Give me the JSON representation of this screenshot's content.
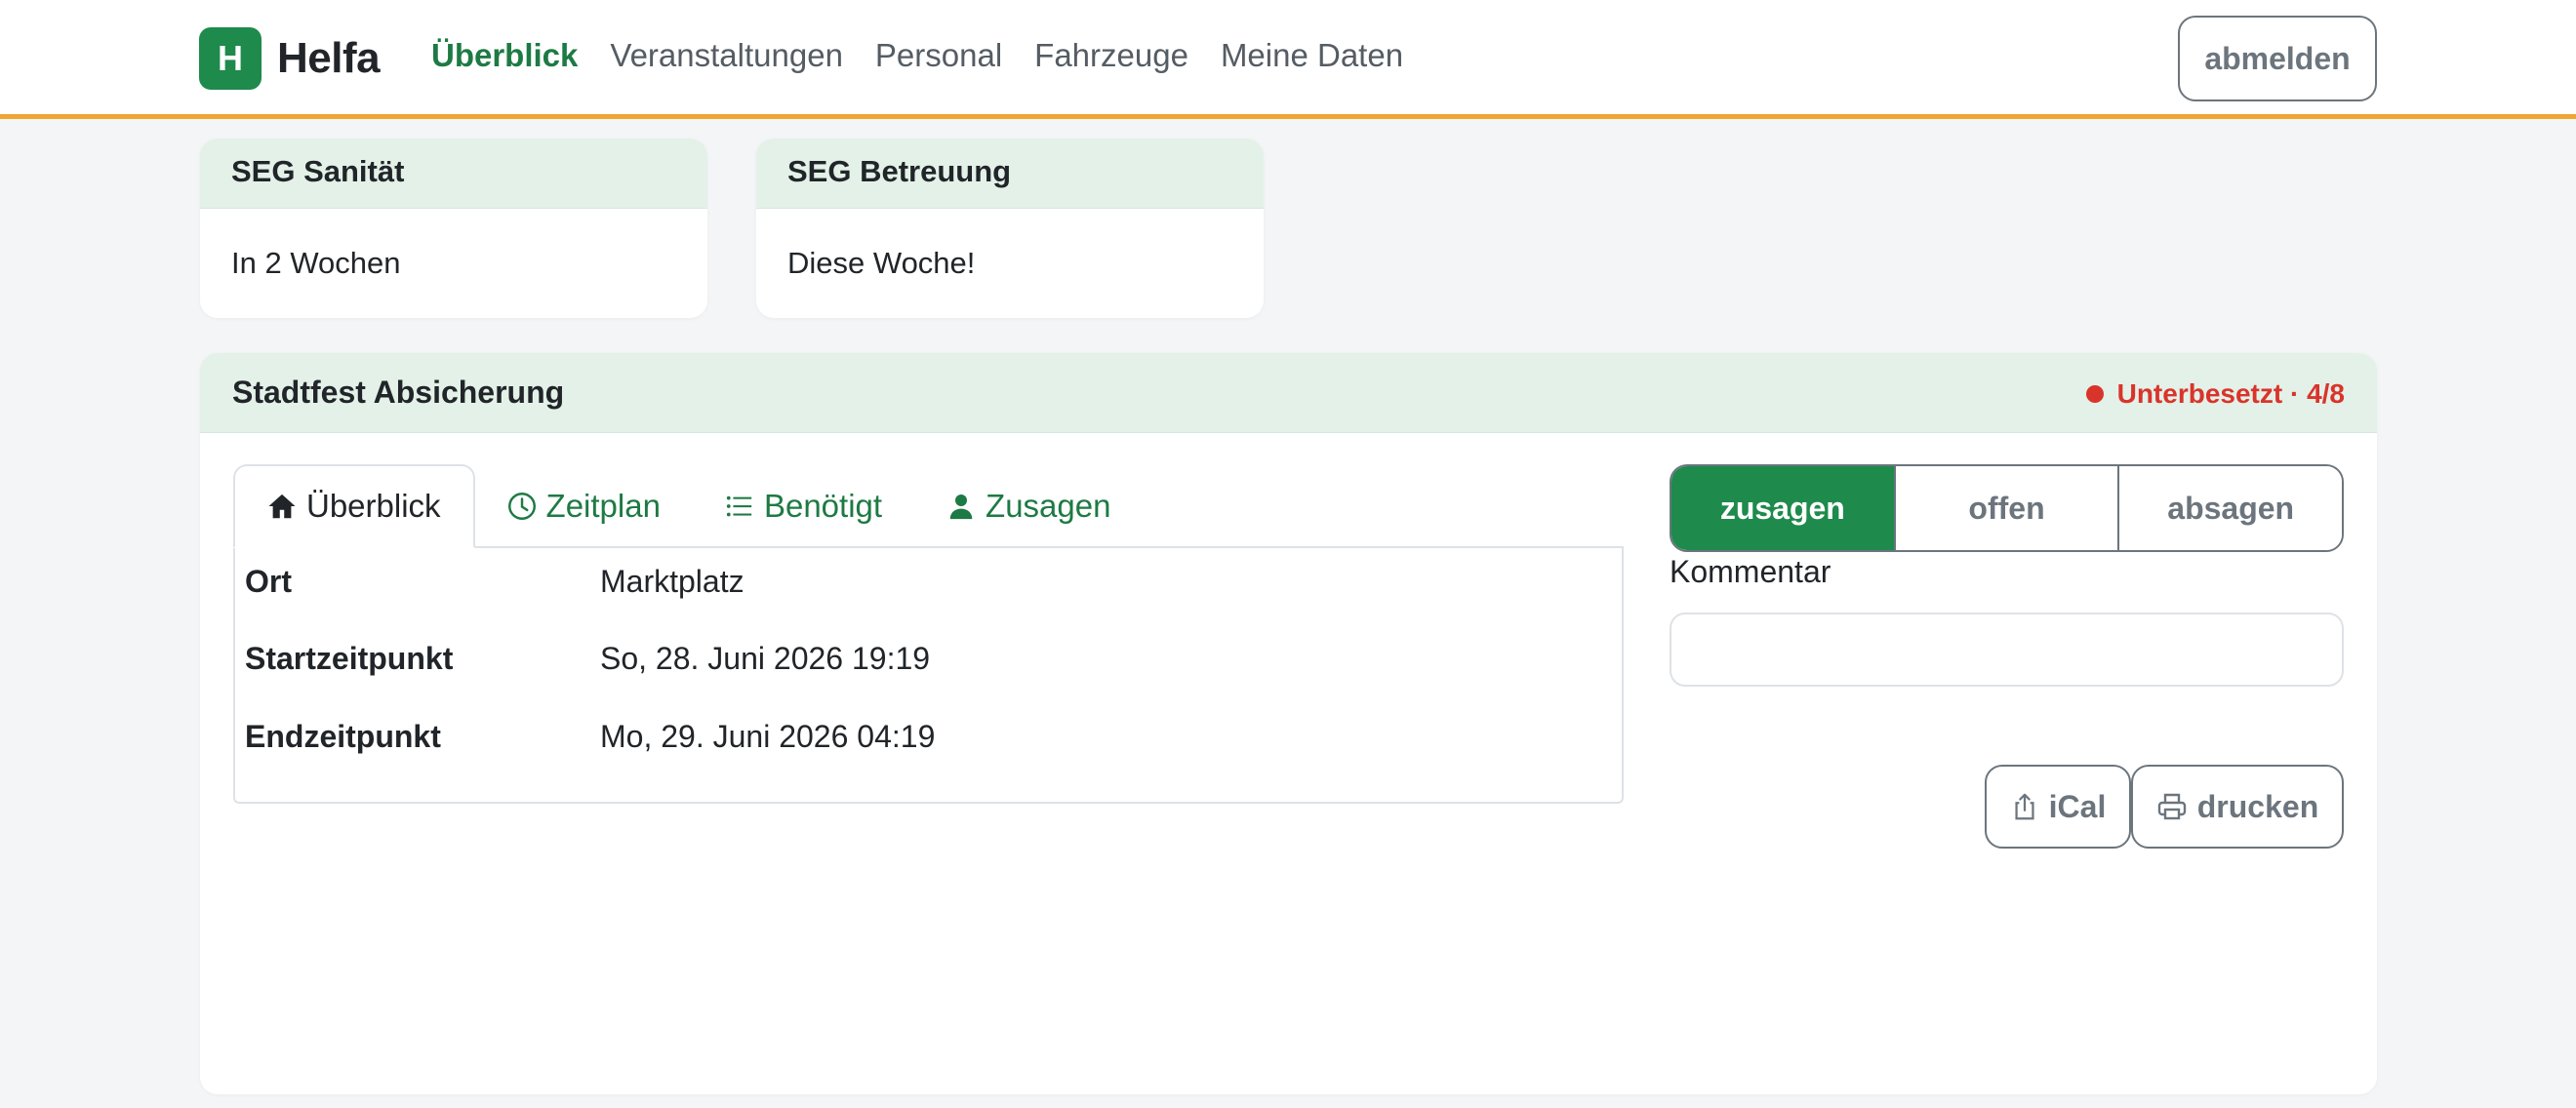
{
  "brand": {
    "logo_letter": "H",
    "name": "Helfa",
    "logo_color": "#1e8a4c"
  },
  "nav": {
    "items": [
      {
        "label": "Überblick",
        "active": true
      },
      {
        "label": "Veranstaltungen",
        "active": false
      },
      {
        "label": "Personal",
        "active": false
      },
      {
        "label": "Fahrzeuge",
        "active": false
      },
      {
        "label": "Meine Daten",
        "active": false
      }
    ],
    "logout_label": "abmelden",
    "accent_color": "#f0a531"
  },
  "groups": [
    {
      "name": "SEG Sanität",
      "info": "In 2 Wochen"
    },
    {
      "name": "SEG Betreuung",
      "info": "Diese Woche!"
    }
  ],
  "event": {
    "title": "Stadtfest Absicherung",
    "status": "Unterbesetzt · 4/8",
    "status_color": "#d9342b",
    "tabs": [
      {
        "label": "Überblick",
        "icon": "home-icon",
        "active": true
      },
      {
        "label": "Zeitplan",
        "icon": "clock-icon",
        "active": false
      },
      {
        "label": "Benötigt",
        "icon": "list-icon",
        "active": false
      },
      {
        "label": "Zusagen",
        "icon": "person-icon",
        "active": false
      }
    ],
    "details": [
      {
        "key": "Ort",
        "value": "Marktplatz"
      },
      {
        "key": "Startzeitpunkt",
        "value": "So, 28. Juni 2026 19:19"
      },
      {
        "key": "Endzeitpunkt",
        "value": "Mo, 29. Juni 2026 04:19"
      }
    ],
    "rsvp": {
      "options": [
        "zusagen",
        "offen",
        "absagen"
      ],
      "selected": "zusagen"
    },
    "comment": {
      "label": "Kommentar",
      "value": "",
      "placeholder": ""
    },
    "actions": {
      "ical_label": "iCal",
      "print_label": "drucken"
    }
  }
}
